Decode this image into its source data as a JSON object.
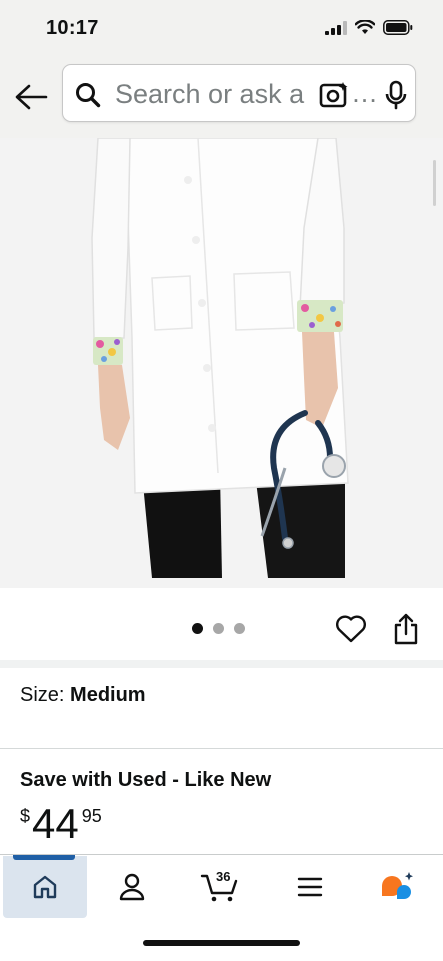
{
  "status_bar": {
    "time": "10:17"
  },
  "header": {
    "search_placeholder": "Search or ask a",
    "search_ellipsis": "…"
  },
  "carousel": {
    "dot_count": 3,
    "active_index": 0
  },
  "size": {
    "label": "Size: ",
    "value": "Medium"
  },
  "offer": {
    "title": "Save with Used - Like New",
    "currency": "$",
    "price_whole": "44",
    "price_fraction": "95"
  },
  "bottom_nav": {
    "items": [
      "home-icon",
      "account-icon",
      "cart-icon",
      "menu-icon",
      "rufus-ai-icon"
    ],
    "cart_count": "36",
    "active": "home"
  },
  "colors": {
    "accent": "#1f5fa6",
    "active_tab_bg": "#dbe4ee",
    "rufus_orange": "#f7761f",
    "rufus_blue": "#1a8fe3"
  }
}
